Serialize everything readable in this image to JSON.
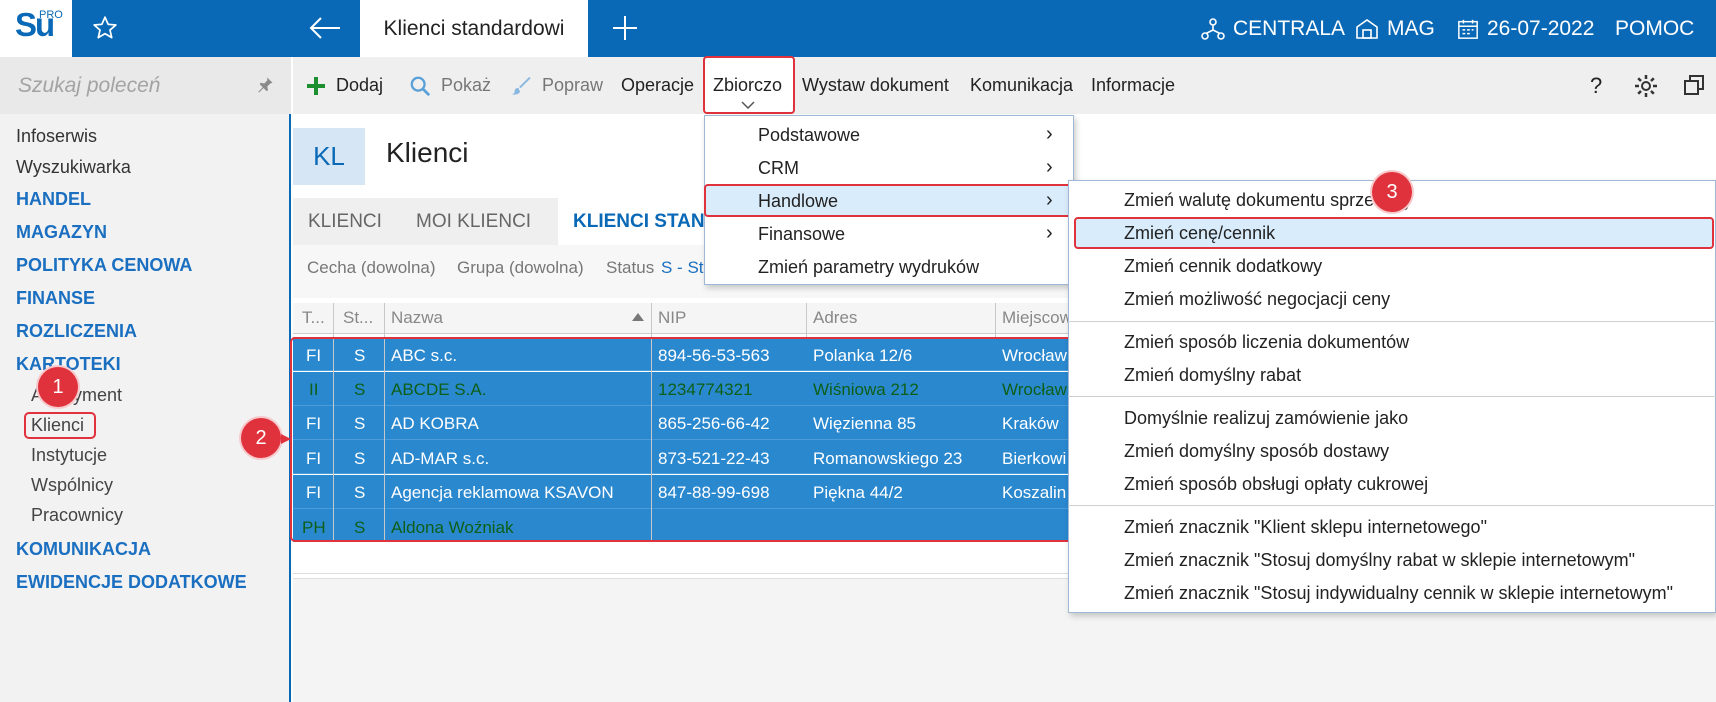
{
  "app": {
    "logo_text": "Su",
    "logo_sup": "PRO",
    "active_tab": "Klienci standardowi",
    "centrala": "CENTRALA",
    "mag": "MAG",
    "date": "26-07-2022",
    "help": "POMOC"
  },
  "sidebar": {
    "search_placeholder": "Szukaj poleceń",
    "items": {
      "infoserwis": "Infoserwis",
      "wyszukiwarka": "Wyszukiwarka",
      "handel": "HANDEL",
      "magazyn": "MAGAZYN",
      "polityka": "POLITYKA CENOWA",
      "finanse": "FINANSE",
      "rozliczenia": "ROZLICZENIA",
      "kartoteki": "KARTOTEKI",
      "asortyment": "Asortyment",
      "klienci": "Klienci",
      "instytucje": "Instytucje",
      "wspolnicy": "Wspólnicy",
      "pracownicy": "Pracownicy",
      "komunikacja": "KOMUNIKACJA",
      "ewidencje": "EWIDENCJE DODATKOWE"
    }
  },
  "toolbar": {
    "dodaj": "Dodaj",
    "pokaz": "Pokaż",
    "popraw": "Popraw",
    "operacje": "Operacje",
    "zbiorczo": "Zbiorczo",
    "wystaw": "Wystaw dokument",
    "komunikacja": "Komunikacja",
    "informacje": "Informacje",
    "help": "?"
  },
  "page": {
    "badge": "KL",
    "title": "Klienci",
    "tabs": [
      "KLIENCI",
      "MOI KLIENCI",
      "KLIENCI STAN"
    ],
    "filters": {
      "cecha": "Cecha (dowolna)",
      "grupa": "Grupa (dowolna)",
      "status_label": "Status",
      "status_value": "S - St"
    }
  },
  "table": {
    "headers": [
      "T...",
      "St...",
      "Nazwa",
      "NIP",
      "Adres",
      "Miejscow"
    ],
    "rows": [
      {
        "t": "FI",
        "st": "S",
        "nazwa": "ABC s.c.",
        "nip": "894-56-53-563",
        "adres": "Polanka  12/6",
        "miejsc": "Wrocław",
        "green": false
      },
      {
        "t": "II",
        "st": "S",
        "nazwa": "ABCDE S.A.",
        "nip": "1234774321",
        "adres": "Wiśniowa 212",
        "miejsc": "Wrocław",
        "green": true
      },
      {
        "t": "FI",
        "st": "S",
        "nazwa": "AD KOBRA",
        "nip": "865-256-66-42",
        "adres": "Więzienna  85",
        "miejsc": "Kraków",
        "green": false
      },
      {
        "t": "FI",
        "st": "S",
        "nazwa": "AD-MAR s.c.",
        "nip": "873-521-22-43",
        "adres": "Romanowskiego 23",
        "miejsc": "Bierkowi",
        "green": false
      },
      {
        "t": "FI",
        "st": "S",
        "nazwa": "Agencja reklamowa KSAVON",
        "nip": "847-88-99-698",
        "adres": "Piękna  44/2",
        "miejsc": "Koszalin",
        "green": false
      },
      {
        "t": "PH",
        "st": "S",
        "nazwa": "Aldona Woźniak",
        "nip": "",
        "adres": "",
        "miejsc": "",
        "green": true
      }
    ]
  },
  "menu1": {
    "items": [
      "Podstawowe",
      "CRM",
      "Handlowe",
      "Finansowe",
      "Zmień parametry wydruków"
    ],
    "chevron": "›"
  },
  "menu2": {
    "items": [
      "Zmień walutę dokumentu sprzedaży",
      "Zmień cenę/cennik",
      "Zmień cennik dodatkowy",
      "Zmień możliwość negocjacji ceny",
      "Zmień sposób liczenia dokumentów",
      "Zmień domyślny rabat",
      "Domyślnie realizuj zamówienie jako",
      "Zmień domyślny sposób dostawy",
      "Zmień sposób obsługi opłaty cukrowej",
      "Zmień znacznik \"Klient sklepu internetowego\"",
      "Zmień znacznik \"Stosuj domyślny rabat w sklepie internetowym\"",
      "Zmień znacznik \"Stosuj indywidualny cennik w sklepie internetowym\""
    ]
  },
  "annotations": [
    "1",
    "2",
    "3"
  ],
  "colors": {
    "brand": "#0a69b6",
    "highlight": "#e0323c",
    "selection": "#2a88cf"
  }
}
